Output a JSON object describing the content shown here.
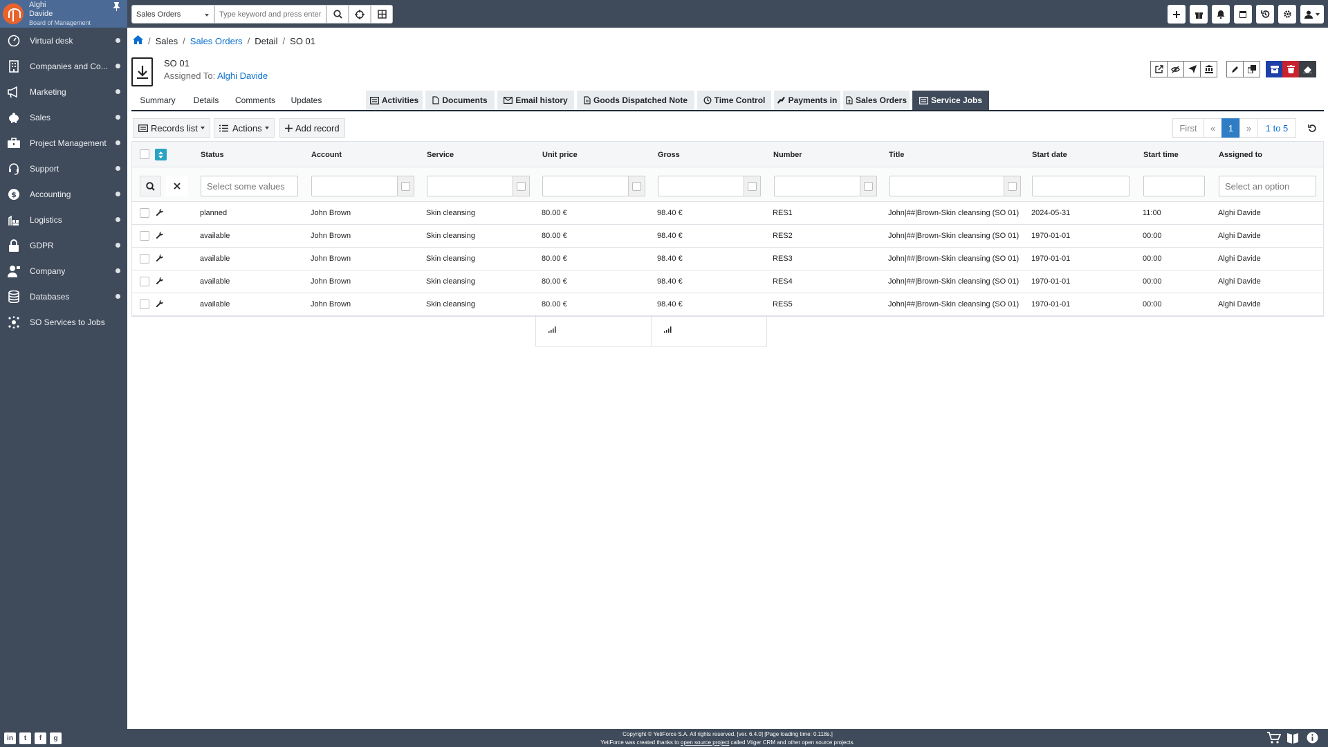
{
  "user": {
    "first": "Alghi",
    "last": "Davide",
    "role": "Board of Management"
  },
  "sidebar": {
    "items": [
      {
        "label": "Virtual desk",
        "icon": "gauge-icon"
      },
      {
        "label": "Companies and Co...",
        "icon": "building-icon"
      },
      {
        "label": "Marketing",
        "icon": "megaphone-icon"
      },
      {
        "label": "Sales",
        "icon": "piggy-bank-icon"
      },
      {
        "label": "Project Management",
        "icon": "briefcase-icon"
      },
      {
        "label": "Support",
        "icon": "headset-icon"
      },
      {
        "label": "Accounting",
        "icon": "dollar-icon"
      },
      {
        "label": "Logistics",
        "icon": "warehouse-icon"
      },
      {
        "label": "GDPR",
        "icon": "lock-icon"
      },
      {
        "label": "Company",
        "icon": "user-tie-icon"
      },
      {
        "label": "Databases",
        "icon": "database-icon"
      },
      {
        "label": "SO Services to Jobs",
        "icon": "network-icon"
      }
    ]
  },
  "topbar": {
    "module": "Sales Orders",
    "search_placeholder": "Type keyword and press enter"
  },
  "breadcrumb": {
    "sales": "Sales",
    "module": "Sales Orders",
    "view": "Detail",
    "record": "SO 01"
  },
  "record": {
    "title": "SO 01",
    "assigned_label": "Assigned To:",
    "assigned_value": "Alghi Davide"
  },
  "tabs": {
    "summary": "Summary",
    "details": "Details",
    "comments": "Comments",
    "updates": "Updates",
    "activities": "Activities",
    "documents": "Documents",
    "email_history": "Email history",
    "goods": "Goods Dispatched Note",
    "time_control": "Time Control",
    "payments": "Payments in",
    "sales_orders": "Sales Orders",
    "service_jobs": "Service Jobs"
  },
  "listview": {
    "records_list": "Records list",
    "actions": "Actions",
    "add_record": "Add record",
    "pagination": {
      "first": "First",
      "prev": "«",
      "page": "1",
      "next": "»",
      "range": "1 to 5"
    }
  },
  "columns": {
    "status": "Status",
    "account": "Account",
    "service": "Service",
    "unit_price": "Unit price",
    "gross": "Gross",
    "number": "Number",
    "title": "Title",
    "start_date": "Start date",
    "start_time": "Start time",
    "assigned_to": "Assigned to"
  },
  "filters": {
    "status_placeholder": "Select some values",
    "assigned_placeholder": "Select an option"
  },
  "rows": [
    {
      "status": "planned",
      "account": "John Brown",
      "service": "Skin cleansing",
      "unit_price": "80.00 €",
      "gross": "98.40 €",
      "number": "RES1",
      "title": "John|##|Brown-Skin cleansing (SO 01)",
      "start_date": "2024-05-31",
      "start_time": "11:00",
      "assigned": "Alghi Davide"
    },
    {
      "status": "available",
      "account": "John Brown",
      "service": "Skin cleansing",
      "unit_price": "80.00 €",
      "gross": "98.40 €",
      "number": "RES2",
      "title": "John|##|Brown-Skin cleansing (SO 01)",
      "start_date": "1970-01-01",
      "start_time": "00:00",
      "assigned": "Alghi Davide"
    },
    {
      "status": "available",
      "account": "John Brown",
      "service": "Skin cleansing",
      "unit_price": "80.00 €",
      "gross": "98.40 €",
      "number": "RES3",
      "title": "John|##|Brown-Skin cleansing (SO 01)",
      "start_date": "1970-01-01",
      "start_time": "00:00",
      "assigned": "Alghi Davide"
    },
    {
      "status": "available",
      "account": "John Brown",
      "service": "Skin cleansing",
      "unit_price": "80.00 €",
      "gross": "98.40 €",
      "number": "RES4",
      "title": "John|##|Brown-Skin cleansing (SO 01)",
      "start_date": "1970-01-01",
      "start_time": "00:00",
      "assigned": "Alghi Davide"
    },
    {
      "status": "available",
      "account": "John Brown",
      "service": "Skin cleansing",
      "unit_price": "80.00 €",
      "gross": "98.40 €",
      "number": "RES5",
      "title": "John|##|Brown-Skin cleansing (SO 01)",
      "start_date": "1970-01-01",
      "start_time": "00:00",
      "assigned": "Alghi Davide"
    }
  ],
  "footer": {
    "line1": "Copyright © YetiForce S.A. All rights reserved. [ver. 6.4.0] [Page loading time: 0.118s.]",
    "line2_pre": "YetiForce was created thanks to ",
    "line2_link": "open source project",
    "line2_post": " called Vtiger CRM and other open source projects."
  },
  "colors": {
    "sidebar": "#3f4a5a",
    "user_box": "#4b6a95",
    "link": "#0a6fcf",
    "page_active": "#2f7dc4"
  }
}
